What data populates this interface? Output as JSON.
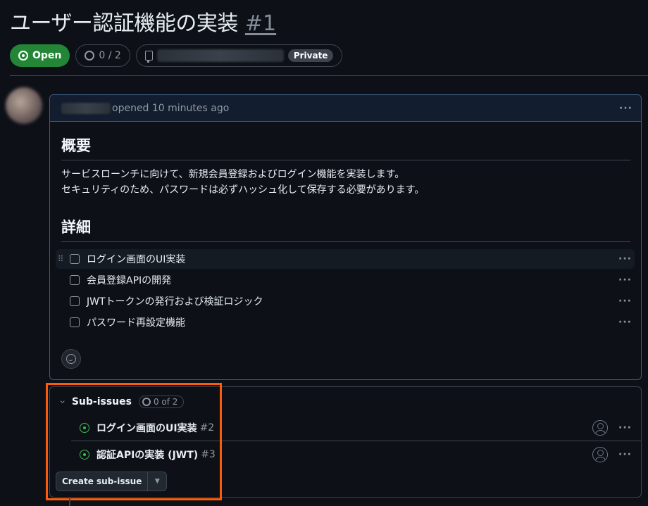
{
  "issue": {
    "title": "ユーザー認証機能の実装",
    "number": "#1",
    "status": "Open",
    "progress": "0 / 2",
    "repo_visibility": "Private"
  },
  "comment": {
    "action_text": "opened 10 minutes ago",
    "heading_overview": "概要",
    "paragraph_line1": "サービスローンチに向けて、新規会員登録およびログイン機能を実装します。",
    "paragraph_line2": "セキュリティのため、パスワードは必ずハッシュ化して保存する必要があります。",
    "heading_details": "詳細",
    "tasks": [
      {
        "label": "ログイン画面のUI実装",
        "checked": false
      },
      {
        "label": "会員登録APIの開発",
        "checked": false
      },
      {
        "label": "JWTトークンの発行および検証ロジック",
        "checked": false
      },
      {
        "label": "パスワード再設定機能",
        "checked": false
      }
    ],
    "more_label": "···"
  },
  "subissues": {
    "title": "Sub-issues",
    "count": "0 of 2",
    "items": [
      {
        "label": "ログイン画面のUI実装",
        "number": "#2"
      },
      {
        "label": "認証APIの実装 (JWT)",
        "number": "#3"
      }
    ],
    "create_button": "Create sub-issue"
  },
  "colors": {
    "open_green": "#238636",
    "highlight": "#ff5a0a",
    "background": "#0d1117"
  },
  "icons": [
    "issue-opened-icon",
    "circle-icon",
    "repo-icon",
    "kebab-icon",
    "grabber-icon",
    "smiley-icon",
    "chevron-down-icon",
    "person-icon",
    "triangle-down-icon"
  ]
}
